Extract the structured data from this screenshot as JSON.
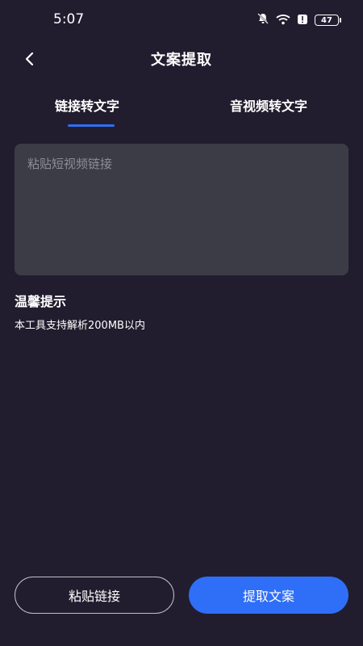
{
  "status_bar": {
    "time": "5:07",
    "battery": "47",
    "icons": [
      "bell-off-icon",
      "wifi-icon",
      "alert-icon",
      "battery-icon"
    ]
  },
  "nav": {
    "title": "文案提取",
    "back_icon": "chevron-left-icon"
  },
  "tabs": [
    {
      "label": "链接转文字",
      "active": true
    },
    {
      "label": "音视频转文字",
      "active": false
    }
  ],
  "input": {
    "placeholder": "粘贴短视频链接",
    "value": ""
  },
  "tips": {
    "title": "温馨提示",
    "text": "本工具支持解析200MB以内"
  },
  "buttons": {
    "paste": "粘贴链接",
    "extract": "提取文案"
  },
  "colors": {
    "background": "#211d2e",
    "input_bg": "#3c3c47",
    "accent": "#2f6ef6"
  }
}
